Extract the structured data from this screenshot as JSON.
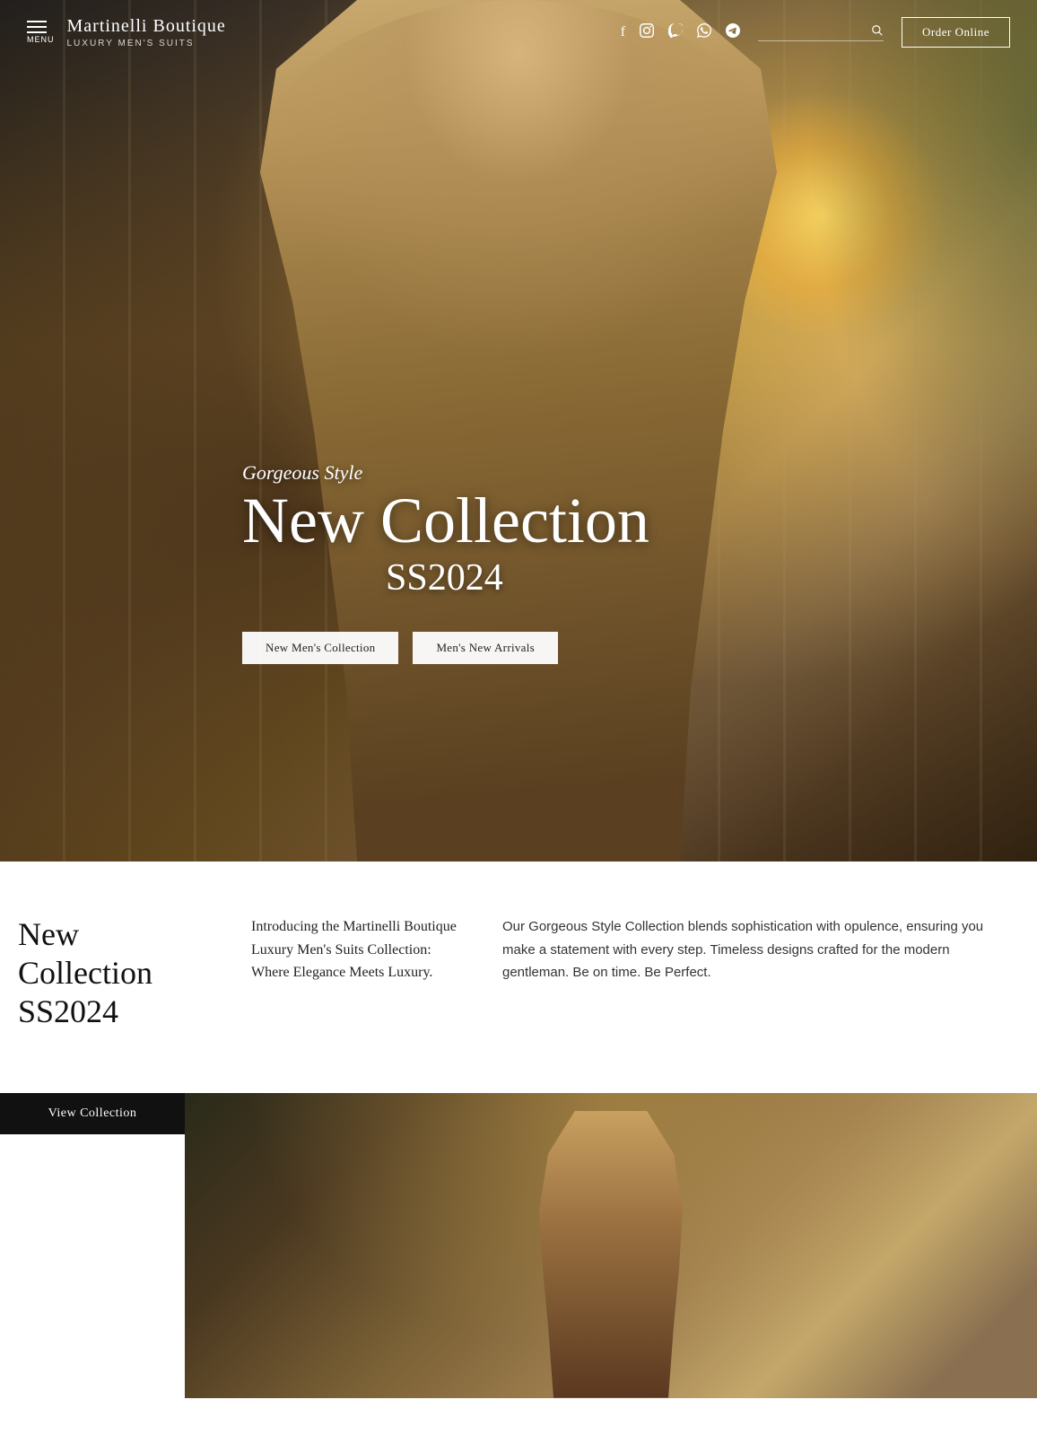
{
  "brand": {
    "name": "Martinelli Boutique",
    "tagline": "Luxury Men's Suits"
  },
  "nav": {
    "menu_label": "MENU",
    "order_button": "Order Online",
    "search_placeholder": ""
  },
  "social": {
    "facebook": "f",
    "instagram": "📷",
    "viber": "📞",
    "whatsapp": "💬",
    "telegram": "✈"
  },
  "hero": {
    "subtitle": "Gorgeous Style",
    "title": "New Collection",
    "year": "SS2024",
    "btn1": "New Men's Collection",
    "btn2": "Men's New Arrivals"
  },
  "info": {
    "col1_title_line1": "New Collection",
    "col1_title_line2": "SS2024",
    "col2_text": "Introducing the Martinelli Boutique Luxury Men's Suits Collection:  Where Elegance Meets Luxury.",
    "col3_text": "Our Gorgeous Style Collection blends sophistication with opulence, ensuring you make a statement with every step. Timeless designs crafted for the modern gentleman. Be on time. Be Perfect."
  },
  "second": {
    "view_collection_btn": "View Collection"
  }
}
